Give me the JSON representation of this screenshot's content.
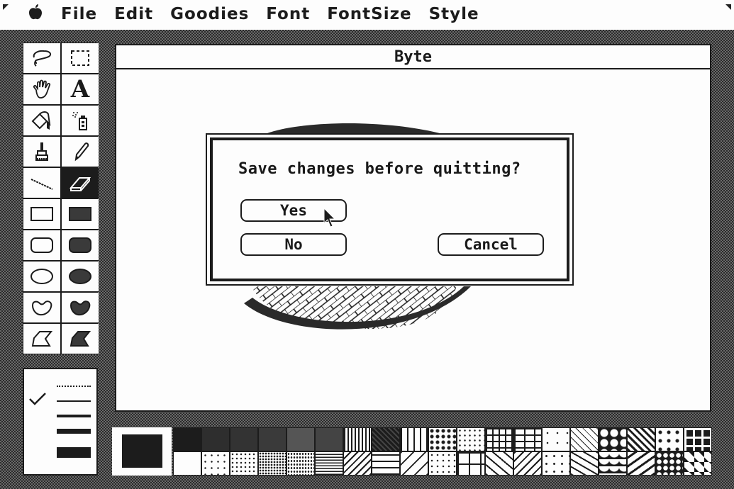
{
  "menubar": {
    "apple_icon": "apple-icon",
    "items": [
      "File",
      "Edit",
      "Goodies",
      "Font",
      "FontSize",
      "Style"
    ]
  },
  "toolbox": {
    "tools": [
      {
        "name": "lasso",
        "icon": "lasso-icon"
      },
      {
        "name": "selection-rectangle",
        "icon": "marquee-icon"
      },
      {
        "name": "grabber",
        "icon": "hand-icon"
      },
      {
        "name": "text",
        "icon": "text-a-icon",
        "glyph": "A"
      },
      {
        "name": "paint-bucket",
        "icon": "paint-bucket-icon"
      },
      {
        "name": "spray-can",
        "icon": "spray-can-icon"
      },
      {
        "name": "paintbrush",
        "icon": "paintbrush-icon"
      },
      {
        "name": "pencil",
        "icon": "pencil-icon"
      },
      {
        "name": "line",
        "icon": "line-icon"
      },
      {
        "name": "eraser",
        "icon": "eraser-icon",
        "selected": true
      },
      {
        "name": "rectangle",
        "icon": "rectangle-icon"
      },
      {
        "name": "filled-rectangle",
        "icon": "filled-rectangle-icon"
      },
      {
        "name": "rounded-rectangle",
        "icon": "rounded-rectangle-icon"
      },
      {
        "name": "filled-rounded-rectangle",
        "icon": "filled-rounded-rectangle-icon"
      },
      {
        "name": "oval",
        "icon": "oval-icon"
      },
      {
        "name": "filled-oval",
        "icon": "filled-oval-icon"
      },
      {
        "name": "freeform",
        "icon": "freeform-icon"
      },
      {
        "name": "filled-freeform",
        "icon": "filled-freeform-icon"
      },
      {
        "name": "polygon",
        "icon": "polygon-icon"
      },
      {
        "name": "filled-polygon",
        "icon": "filled-polygon-icon"
      }
    ]
  },
  "line_widths": {
    "options": [
      "dotted",
      "1px",
      "2px",
      "4px",
      "8px"
    ],
    "selected_index": 1,
    "check_icon": "checkmark-icon"
  },
  "window": {
    "title": "Byte"
  },
  "dialog": {
    "message": "Save changes before quitting?",
    "buttons": {
      "yes": "Yes",
      "no": "No",
      "cancel": "Cancel"
    },
    "cursor_icon": "arrow-cursor-icon"
  },
  "patterns": {
    "current": "black",
    "count": 38
  },
  "colors": {
    "ink": "#1c1c1c",
    "paper": "#fdfdfd",
    "desktop_gray": "#6a6a6a"
  }
}
